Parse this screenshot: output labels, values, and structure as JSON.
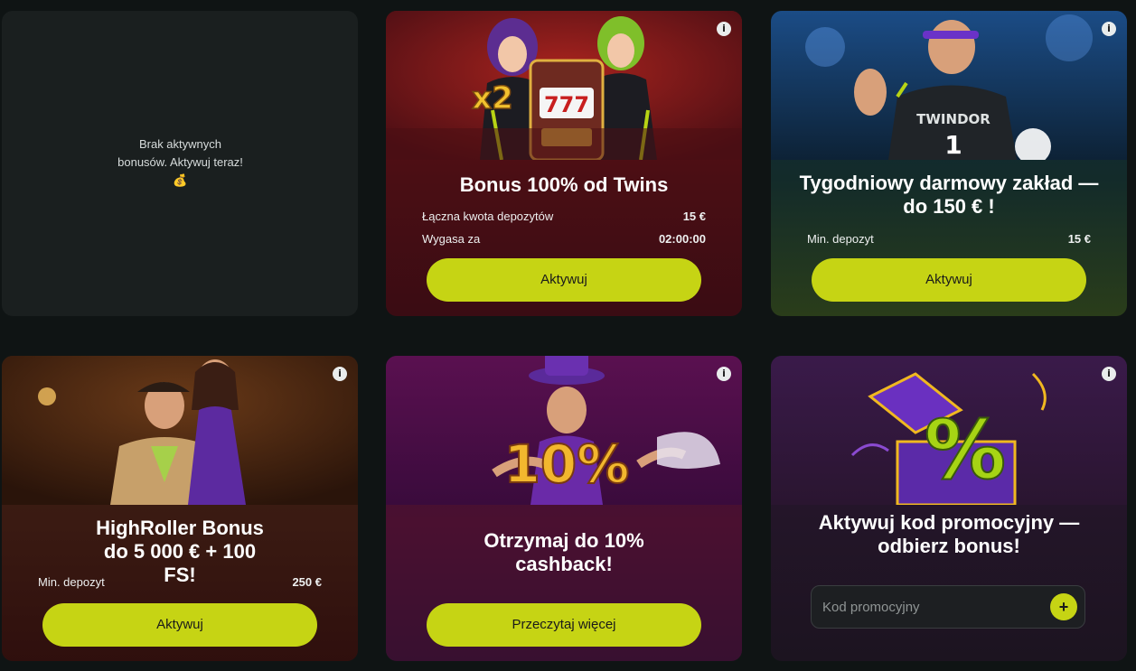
{
  "empty_card": {
    "text": "Brak aktywnych bonusów. Aktywuj teraz! 💰"
  },
  "cards": [
    {
      "title": "Bonus 100% od Twins",
      "rows": [
        {
          "label": "Łączna kwota depozytów",
          "value": "15 €"
        },
        {
          "label": "Wygasa za",
          "value": "02:00:00"
        }
      ],
      "art_badge": "x2",
      "slot_text": "777",
      "button": "Aktywuj"
    },
    {
      "title": "Tygodniowy darmowy zakład — do 150 € !",
      "rows": [
        {
          "label": "Min. depozyt",
          "value": "15 €"
        }
      ],
      "jersey_text": "TWINDOR",
      "jersey_number": "1",
      "button": "Aktywuj"
    },
    {
      "title": "HighRoller Bonus do 5 000 € + 100 FS!",
      "rows": [
        {
          "label": "Min. depozyt",
          "value": "250 €"
        }
      ],
      "button": "Aktywuj"
    },
    {
      "title": "Otrzymaj do 10% cashback!",
      "art_text": "10%",
      "button": "Przeczytaj więcej"
    },
    {
      "title": "Aktywuj kod promocyjny — odbierz bonus!",
      "art_text": "%",
      "promo_placeholder": "Kod promocyjny",
      "promo_button": "+"
    }
  ],
  "info_icon": "i",
  "colors": {
    "accent": "#c6d414",
    "background": "#0f1414"
  }
}
